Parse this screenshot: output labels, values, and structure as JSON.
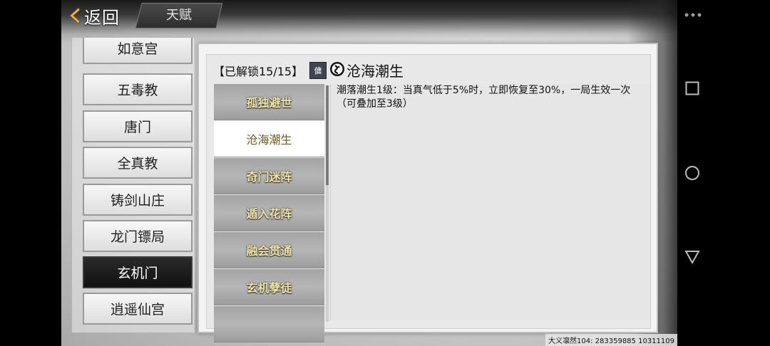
{
  "header": {
    "back_label": "返回",
    "tab_label": "天赋"
  },
  "sects": [
    {
      "label": "如意宫"
    },
    {
      "label": "五毒教"
    },
    {
      "label": "唐门"
    },
    {
      "label": "全真教"
    },
    {
      "label": "铸剑山庄"
    },
    {
      "label": "龙门镖局"
    },
    {
      "label": "玄机门"
    },
    {
      "label": "逍遥仙宫"
    }
  ],
  "selected_sect": "玄机门",
  "detail": {
    "unlock_text": "【已解锁15/15】",
    "seal_text": "傭",
    "title": "沧海潮生",
    "description": "潮落潮生1级：当真气低于5%时，立即恢复至30%，一局生效一次（可叠加至3级）"
  },
  "talents": [
    {
      "label": "孤独避世"
    },
    {
      "label": "沧海潮生"
    },
    {
      "label": "奇门迷阵"
    },
    {
      "label": "遁入花阵"
    },
    {
      "label": "融会贯通"
    },
    {
      "label": "玄机孽徒"
    },
    {
      "label": ""
    }
  ],
  "selected_talent": "沧海潮生",
  "watermark": "大义凛然104: 283359885  10311109",
  "colors": {
    "talent_text": "#f1e6a8",
    "selected_sect_bg": "#1a1a1a",
    "panel_bg": "#f3f3f3"
  },
  "icons": [
    "back-chevron-icon",
    "yinyang-icon",
    "seal-icon",
    "menu-dots-icon",
    "square-icon",
    "circle-icon",
    "triangle-icon"
  ]
}
